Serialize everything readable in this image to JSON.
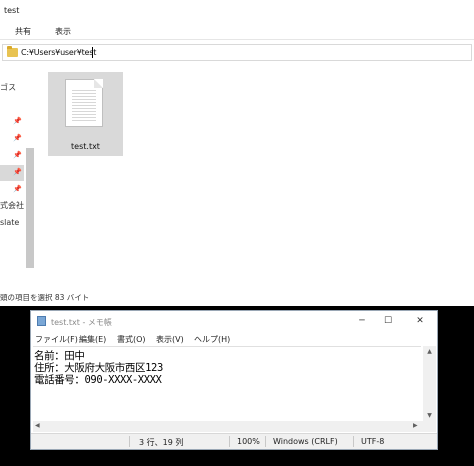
{
  "explorer": {
    "title": "test",
    "ribbon_tabs": [
      "共有",
      "表示"
    ],
    "address": "C:¥Users¥user¥test",
    "nav_items": [
      "ゴス",
      "",
      "",
      "",
      "",
      "",
      "式会社",
      "slate"
    ],
    "file": {
      "name": "test.txt"
    },
    "status": "頭の項目を選択  83 バイト"
  },
  "notepad": {
    "title": "test.txt - メモ帳",
    "window_buttons": [
      "─",
      "☐",
      "✕"
    ],
    "menu": [
      "ファイル(F)",
      "編集(E)",
      "書式(O)",
      "表示(V)",
      "ヘルプ(H)"
    ],
    "lines": [
      "名前：田中",
      "住所：大阪府大阪市西区123",
      "電話番号：090-XXXX-XXXX"
    ],
    "status": {
      "position": "3 行、19 列",
      "zoom": "100%",
      "line_ending": "Windows (CRLF)",
      "encoding": "UTF-8"
    }
  },
  "colors": {
    "folder": "#e8c352",
    "selection": "#d9d9d9",
    "notepad_border": "#9aa7b5"
  }
}
